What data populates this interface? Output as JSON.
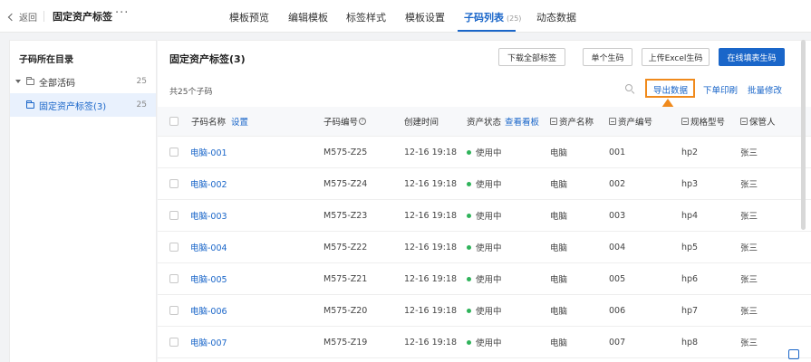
{
  "topbar": {
    "back_label": "返回",
    "doc_title": "固定资产标签",
    "more_label": "···",
    "tabs": [
      {
        "label": "模板预览"
      },
      {
        "label": "编辑模板"
      },
      {
        "label": "标签样式"
      },
      {
        "label": "模板设置"
      },
      {
        "label": "子码列表",
        "count": "(25)"
      },
      {
        "label": "动态数据"
      }
    ]
  },
  "sidebar": {
    "title": "子码所在目录",
    "items": [
      {
        "label": "全部活码",
        "count": "25"
      },
      {
        "label": "固定资产标签(3)",
        "count": "25"
      }
    ]
  },
  "main": {
    "title": "固定资产标签(3)",
    "buttons": {
      "download_all": "下载全部标签",
      "single_gen": "单个生码",
      "upload_excel": "上传Excel生码",
      "online_fill": "在线填表生码"
    },
    "count_text": "共25个子码",
    "links": {
      "export": "导出数据",
      "print": "下单印刷",
      "batch_edit": "批量修改"
    },
    "table": {
      "headers": {
        "name": "子码名称",
        "settings": "设置",
        "code": "子码编号",
        "created": "创建时间",
        "status": "资产状态",
        "view_board": "查看看板",
        "asset_name": "资产名称",
        "asset_no": "资产编号",
        "model": "规格型号",
        "keeper": "保管人"
      },
      "rows": [
        {
          "name": "电脑-001",
          "code": "M575-Z25",
          "created": "12-16 19:18",
          "status": "使用中",
          "asset_name": "电脑",
          "asset_no": "001",
          "model": "hp2",
          "keeper": "张三"
        },
        {
          "name": "电脑-002",
          "code": "M575-Z24",
          "created": "12-16 19:18",
          "status": "使用中",
          "asset_name": "电脑",
          "asset_no": "002",
          "model": "hp3",
          "keeper": "张三"
        },
        {
          "name": "电脑-003",
          "code": "M575-Z23",
          "created": "12-16 19:18",
          "status": "使用中",
          "asset_name": "电脑",
          "asset_no": "003",
          "model": "hp4",
          "keeper": "张三"
        },
        {
          "name": "电脑-004",
          "code": "M575-Z22",
          "created": "12-16 19:18",
          "status": "使用中",
          "asset_name": "电脑",
          "asset_no": "004",
          "model": "hp5",
          "keeper": "张三"
        },
        {
          "name": "电脑-005",
          "code": "M575-Z21",
          "created": "12-16 19:18",
          "status": "使用中",
          "asset_name": "电脑",
          "asset_no": "005",
          "model": "hp6",
          "keeper": "张三"
        },
        {
          "name": "电脑-006",
          "code": "M575-Z20",
          "created": "12-16 19:18",
          "status": "使用中",
          "asset_name": "电脑",
          "asset_no": "006",
          "model": "hp7",
          "keeper": "张三"
        },
        {
          "name": "电脑-007",
          "code": "M575-Z19",
          "created": "12-16 19:18",
          "status": "使用中",
          "asset_name": "电脑",
          "asset_no": "007",
          "model": "hp8",
          "keeper": "张三"
        }
      ]
    }
  },
  "colors": {
    "accent": "#1a66c9",
    "highlight": "#f08a1c",
    "status_green": "#2fb35a"
  }
}
